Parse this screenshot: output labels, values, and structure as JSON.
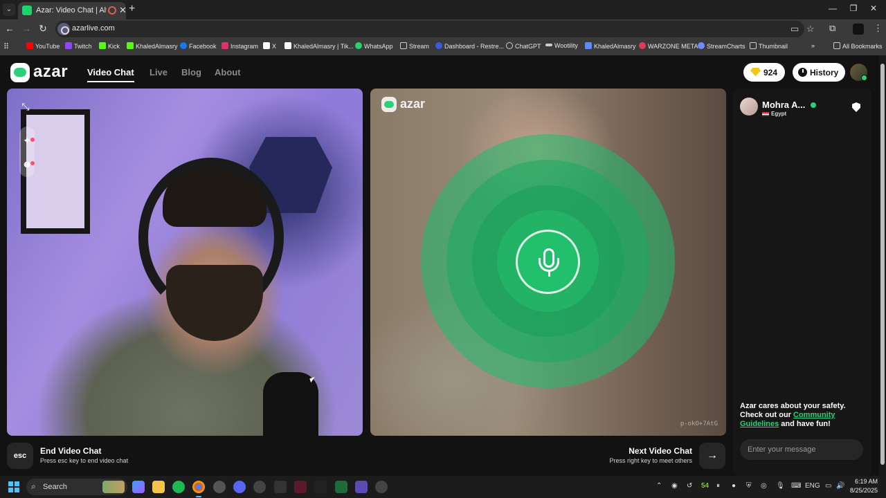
{
  "browser": {
    "tab_title": "Azar: Video Chat | Alternati",
    "url": "azarlive.com",
    "bookmarks": [
      {
        "label": "YouTube",
        "color": "#ff0000"
      },
      {
        "label": "Twitch",
        "color": "#9146ff"
      },
      {
        "label": "Kick",
        "color": "#53fc18"
      },
      {
        "label": "KhaledAlmasry",
        "color": "#53fc18"
      },
      {
        "label": "Facebook",
        "color": "#1877f2"
      },
      {
        "label": "Instagram",
        "color": "#e1306c"
      },
      {
        "label": "X",
        "color": "#ffffff"
      },
      {
        "label": "KhaledAlmasry | Tik...",
        "color": "#ffffff"
      },
      {
        "label": "WhatsApp",
        "color": "#25d366"
      },
      {
        "label": "Stream",
        "color": "#cccccc"
      },
      {
        "label": "Dashboard - Restre...",
        "color": "#3b5bdb"
      },
      {
        "label": "ChatGPT",
        "color": "#cccccc"
      },
      {
        "label": "Wootility",
        "color": "#cccccc"
      },
      {
        "label": "KhaledAlmasry",
        "color": "#5b8cff"
      },
      {
        "label": "WARZONE META",
        "color": "#e03a5a"
      },
      {
        "label": "StreamCharts",
        "color": "#6c8cff"
      },
      {
        "label": "Thumbnail",
        "color": "#cccccc"
      }
    ],
    "all_bookmarks": "All Bookmarks"
  },
  "header": {
    "logo_text": "azar",
    "nav": [
      "Video Chat",
      "Live",
      "Blog",
      "About"
    ],
    "gems": "924",
    "history": "History"
  },
  "remote": {
    "logo_text": "azar",
    "id": "p-okO+7AtG"
  },
  "chat": {
    "name": "Mohra A...",
    "country": "Egypt",
    "safety_line1": "Azar cares about your safety.",
    "safety_line2_prefix": "Check out our ",
    "safety_link": "Community Guidelines",
    "safety_suffix": " and have fun!",
    "input_placeholder": "Enter your message"
  },
  "actions": {
    "esc_key": "esc",
    "end_title": "End Video Chat",
    "end_sub": "Press esc key to end video chat",
    "next_title": "Next Video Chat",
    "next_sub": "Press right key to meet others"
  },
  "taskbar": {
    "search": "Search",
    "tray_number": "54",
    "lang": "ENG",
    "time": "6:19 AM",
    "date": "8/25/2025"
  },
  "colors": {
    "accent_green": "#2bd17a",
    "gem_gold": "#f5c518"
  }
}
